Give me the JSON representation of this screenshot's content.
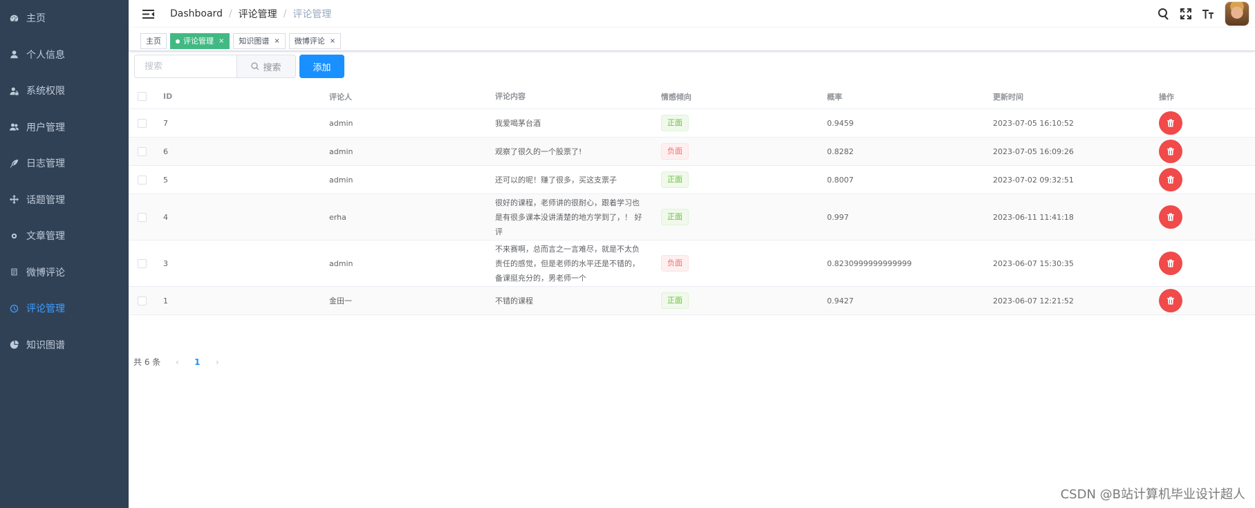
{
  "sidebar": {
    "items": [
      {
        "label": "主页",
        "icon": "dashboard-icon",
        "active": false
      },
      {
        "label": "个人信息",
        "icon": "user-icon",
        "active": false
      },
      {
        "label": "系统权限",
        "icon": "user-lock-icon",
        "active": false
      },
      {
        "label": "用户管理",
        "icon": "users-icon",
        "active": false
      },
      {
        "label": "日志管理",
        "icon": "feather-icon",
        "active": false
      },
      {
        "label": "话题管理",
        "icon": "move-icon",
        "active": false
      },
      {
        "label": "文章管理",
        "icon": "gear-icon",
        "active": false
      },
      {
        "label": "微博评论",
        "icon": "document-icon",
        "active": false
      },
      {
        "label": "评论管理",
        "icon": "clock-icon",
        "active": true
      },
      {
        "label": "知识图谱",
        "icon": "chart-icon",
        "active": false
      }
    ]
  },
  "breadcrumb": [
    "Dashboard",
    "评论管理",
    "评论管理"
  ],
  "tags": [
    {
      "label": "主页",
      "active": false,
      "closable": false
    },
    {
      "label": "评论管理",
      "active": true,
      "closable": true
    },
    {
      "label": "知识图谱",
      "active": false,
      "closable": true
    },
    {
      "label": "微博评论",
      "active": false,
      "closable": true
    }
  ],
  "close_glyph": "×",
  "filter": {
    "search_placeholder": "搜索",
    "search_button": "搜索",
    "add_button": "添加"
  },
  "table": {
    "columns": [
      "ID",
      "评论人",
      "评论内容",
      "情感倾向",
      "概率",
      "更新时间",
      "操作"
    ],
    "rows": [
      {
        "id": "7",
        "user": "admin",
        "content": "我爱喝茅台酒",
        "emotion": "正面",
        "positive": true,
        "prob": "0.9459",
        "time": "2023-07-05 16:10:52"
      },
      {
        "id": "6",
        "user": "admin",
        "content": "观察了很久的一个股票了!",
        "emotion": "负面",
        "positive": false,
        "prob": "0.8282",
        "time": "2023-07-05 16:09:26"
      },
      {
        "id": "5",
        "user": "admin",
        "content": "还可以的呢！赚了很多，买这支票子",
        "emotion": "正面",
        "positive": true,
        "prob": "0.8007",
        "time": "2023-07-02 09:32:51"
      },
      {
        "id": "4",
        "user": "erha",
        "content": "很好的课程，老师讲的很耐心，跟着学习也是有很多课本没讲清楚的地方学到了，！ 好评",
        "emotion": "正面",
        "positive": true,
        "prob": "0.997",
        "time": "2023-06-11 11:41:18"
      },
      {
        "id": "3",
        "user": "admin",
        "content": "不来赛啊，总而言之一言难尽，就是不太负责任的感觉，但是老师的水平还是不错的，备课挺充分的，男老师一个",
        "emotion": "负面",
        "positive": false,
        "prob": "0.8230999999999999",
        "time": "2023-06-07 15:30:35"
      },
      {
        "id": "1",
        "user": "金田一",
        "content": "不错的课程",
        "emotion": "正面",
        "positive": true,
        "prob": "0.9427",
        "time": "2023-06-07 12:21:52"
      }
    ]
  },
  "pagination": {
    "total_text": "共 6 条",
    "current": "1",
    "prev": "‹",
    "next": "›"
  },
  "watermark": "CSDN @B站计算机毕业设计超人"
}
